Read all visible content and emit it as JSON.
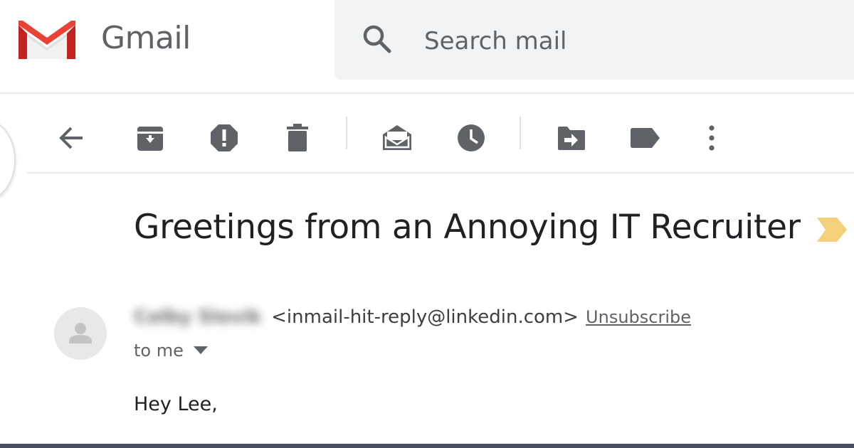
{
  "app": {
    "brand": "Gmail",
    "logo_icon": "gmail-m-logo",
    "accent_color": "#d93025"
  },
  "search": {
    "placeholder": "Search mail",
    "icon": "search-icon"
  },
  "toolbar": {
    "icon_color": "#5f6368",
    "items": [
      {
        "name": "back",
        "icon": "arrow-back-icon"
      },
      {
        "name": "archive",
        "icon": "archive-icon"
      },
      {
        "name": "report-spam",
        "icon": "report-spam-icon"
      },
      {
        "name": "delete",
        "icon": "trash-icon"
      },
      {
        "name": "mark-unread",
        "icon": "mark-unread-icon"
      },
      {
        "name": "snooze",
        "icon": "clock-icon"
      },
      {
        "name": "move-to",
        "icon": "move-to-icon"
      },
      {
        "name": "labels",
        "icon": "label-icon"
      },
      {
        "name": "more",
        "icon": "more-vert-icon"
      }
    ]
  },
  "message": {
    "subject": "Greetings from an Annoying IT Recruiter",
    "importance_icon": "importance-marker-icon",
    "importance_color": "#f5d07a",
    "sender": {
      "name": "Colby Slovik",
      "email": "<inmail-hit-reply@linkedin.com>",
      "unsubscribe_label": "Unsubscribe",
      "avatar_icon": "default-avatar-icon"
    },
    "recipient_label": "to me",
    "body_first_line": "Hey Lee,"
  }
}
